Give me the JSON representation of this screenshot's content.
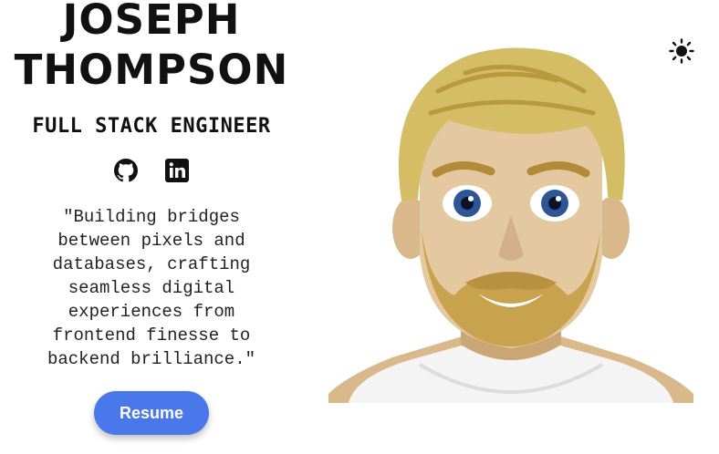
{
  "hero": {
    "name_line1": "JOSEPH",
    "name_line2": "THOMPSON",
    "role": "FULL STACK ENGINEER",
    "quote": "\"Building bridges between pixels and databases, crafting seamless digital experiences from frontend finesse to backend brilliance.\"",
    "resume_label": "Resume"
  },
  "socials": [
    {
      "icon": "github-icon"
    },
    {
      "icon": "linkedin-icon"
    }
  ],
  "theme_toggle": {
    "icon": "sun-icon"
  },
  "colors": {
    "accent": "#4a78ea",
    "text": "#111111",
    "background": "#ffffff"
  }
}
